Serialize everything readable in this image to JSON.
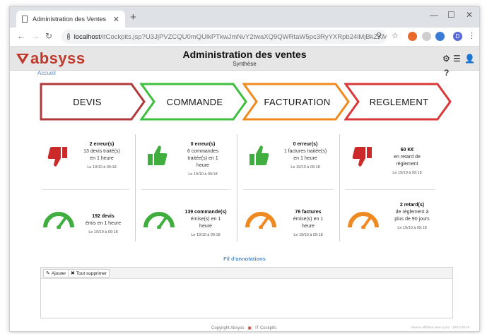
{
  "browser": {
    "tab_title": "Administration des Ventes",
    "url_host": "localhost",
    "url_path": "/itCockpits.jsp?U3JjPVZCQU0mQUlkPTkwJmNvY2twaXQ9QWRtaW5pc3RyYXRpb24lMjBkZXMlMjBWZW5...",
    "profile_letter": "D"
  },
  "app": {
    "logo_text": "absyss",
    "title": "Administration des ventes",
    "subtitle": "Synthèse",
    "breadcrumb": "Accueil",
    "help": "?"
  },
  "steps": [
    {
      "label": "DEVIS",
      "color": "#b03a3a"
    },
    {
      "label": "COMMANDE",
      "color": "#3fbf3f"
    },
    {
      "label": "FACTURATION",
      "color": "#f08a1c"
    },
    {
      "label": "REGLEMENT",
      "color": "#d9383a"
    }
  ],
  "kpis": {
    "devis": {
      "alert": {
        "icon": "thumbs-down-icon",
        "color": "#cc2a2a",
        "main": "2 erreur(s)",
        "line1": "13 devis traité(s)",
        "line2": "en 1 heure",
        "date": "Le 19/10 à 09:18"
      },
      "volume": {
        "icon": "gauge-icon",
        "color": "#3fae3f",
        "main": "192 devis",
        "line1": "émis en 1 heure",
        "date": "Le 19/10 à 09:18"
      }
    },
    "commande": {
      "alert": {
        "icon": "thumbs-up-icon",
        "color": "#3fae3f",
        "main": "0 erreur(s)",
        "line1": "6 commandes",
        "line2": "traitée(s) en 1",
        "line3": "heure",
        "date": "Le 19/10 à 09:18"
      },
      "volume": {
        "icon": "gauge-icon",
        "color": "#3fae3f",
        "main": "139 commande(s)",
        "line1": "émise(s) en 1",
        "line2": "heure",
        "date": "Le 19/10 à 09:18"
      }
    },
    "facturation": {
      "alert": {
        "icon": "thumbs-up-icon",
        "color": "#3fae3f",
        "main": "0 erreur(s)",
        "line1": "1 factures traitée(s)",
        "line2": "en 1 heure",
        "date": "Le 19/10 à 09:18"
      },
      "volume": {
        "icon": "gauge-icon",
        "color": "#ef8a22",
        "main": "76 factures",
        "line1": "émise(s) en 1",
        "line2": "heure",
        "date": "Le 19/10 à 09:18"
      }
    },
    "reglement": {
      "alert": {
        "icon": "thumbs-down-icon",
        "color": "#cc2a2a",
        "main": "60 K€",
        "line1": "en retard de",
        "line2": "règlement",
        "date": "Le 19/10 à 09:18"
      },
      "volume": {
        "icon": "gauge-icon",
        "color": "#ef8a22",
        "main": "2 retard(s)",
        "line1": "de règlement à",
        "line2": "plus de 90 jours",
        "date": "Le 19/10 à 09:18"
      }
    }
  },
  "annotations": {
    "title": "Fil d'annotations",
    "add_label": "Ajouter",
    "clear_label": "Tout supprimer"
  },
  "footer": {
    "copyright": "Copyright Absyss",
    "brand": "IT Cockpits",
    "version": "Version affichée mise à jour : 19/10 09:18"
  }
}
